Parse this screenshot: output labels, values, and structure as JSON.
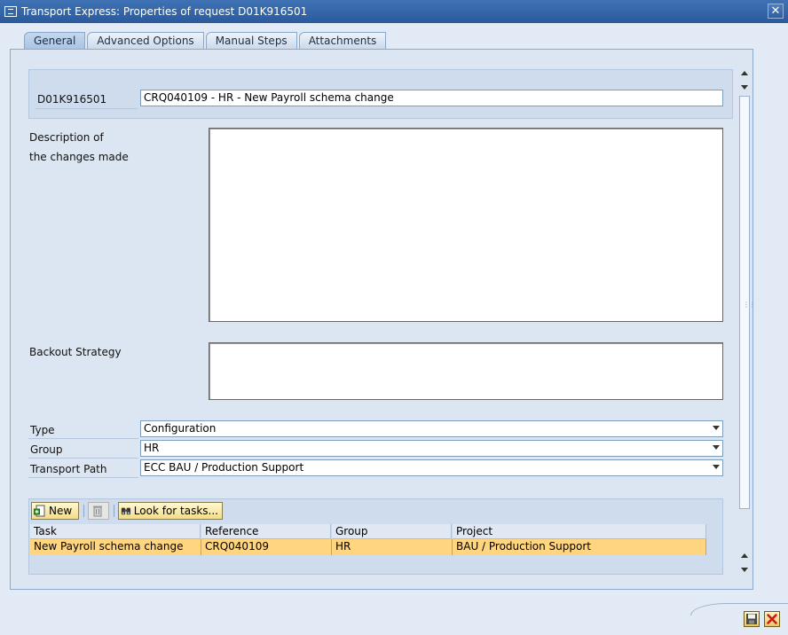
{
  "window": {
    "title": "Transport Express: Properties of request D01K916501"
  },
  "tabs": [
    {
      "label": "General"
    },
    {
      "label": "Advanced Options"
    },
    {
      "label": "Manual Steps"
    },
    {
      "label": "Attachments"
    }
  ],
  "request": {
    "id": "D01K916501",
    "short_text": "CRQ040109 - HR - New Payroll schema change"
  },
  "description": {
    "label_line1": "Description of",
    "label_line2": "the changes made",
    "value": ""
  },
  "backout": {
    "label": "Backout Strategy",
    "value": ""
  },
  "type": {
    "label": "Type",
    "value": "Configuration"
  },
  "group": {
    "label": "Group",
    "value": "HR"
  },
  "transport_path": {
    "label": "Transport Path",
    "value": "ECC BAU / Production Support"
  },
  "tasks_toolbar": {
    "new_label": "New",
    "look_label": "Look for tasks..."
  },
  "tasks_table": {
    "columns": [
      "Task",
      "Reference",
      "Group",
      "Project"
    ],
    "rows": [
      [
        "New Payroll schema change",
        "CRQ040109",
        "HR",
        "BAU / Production Support"
      ]
    ]
  },
  "colors": {
    "title_bar": "#2a5a9c",
    "selected_row": "#ffd580",
    "panel": "#dbe6f2"
  }
}
